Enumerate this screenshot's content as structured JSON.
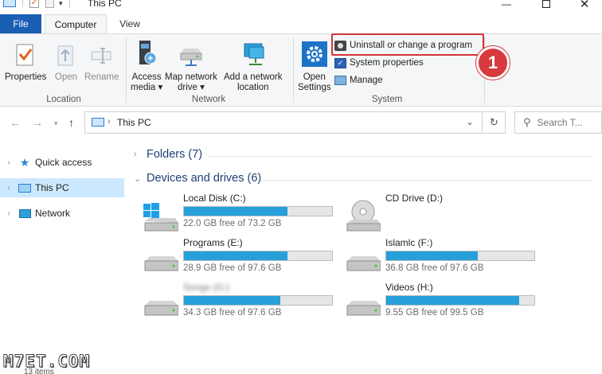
{
  "window": {
    "title": "This PC",
    "controls": [
      "minimize-icon",
      "maximize-icon",
      "close-icon"
    ]
  },
  "ribbon": {
    "tabs": [
      {
        "label": "File"
      },
      {
        "label": "Computer"
      },
      {
        "label": "View"
      }
    ],
    "groups": {
      "location": {
        "label": "Location",
        "buttons": [
          {
            "label": "Properties",
            "icon": "properties-icon"
          },
          {
            "label": "Open",
            "icon": "open-icon"
          },
          {
            "label": "Rename",
            "icon": "rename-icon"
          }
        ]
      },
      "network": {
        "label": "Network",
        "buttons": [
          {
            "label1": "Access",
            "label2": "media ▾",
            "icon": "access-media-icon"
          },
          {
            "label1": "Map network",
            "label2": "drive ▾",
            "icon": "map-network-drive-icon"
          },
          {
            "label1": "Add a network",
            "label2": "location",
            "icon": "add-network-location-icon"
          }
        ]
      },
      "system": {
        "label": "System",
        "open_settings": {
          "label1": "Open",
          "label2": "Settings",
          "icon": "gear-icon"
        },
        "items": [
          {
            "label": "Uninstall or change a program",
            "icon": "uninstall-icon"
          },
          {
            "label": "System properties",
            "icon": "system-properties-icon"
          },
          {
            "label": "Manage",
            "icon": "manage-icon"
          }
        ]
      }
    },
    "callout_number": "1",
    "accent": "#1a5fb4",
    "highlight_color": "#d0343a"
  },
  "address_bar": {
    "path": "This PC",
    "search_placeholder": "Search T..."
  },
  "nav_pane": {
    "items": [
      {
        "label": "Quick access",
        "icon": "star-icon"
      },
      {
        "label": "This PC",
        "icon": "computer-icon",
        "selected": true
      },
      {
        "label": "Network",
        "icon": "network-icon"
      }
    ]
  },
  "content": {
    "folders_heading": "Folders (7)",
    "drives_heading": "Devices and drives (6)",
    "drives": [
      {
        "name": "Local Disk (C:)",
        "free": "22.0 GB free of 73.2 GB",
        "used_fraction": 0.7,
        "icon": "windows-drive-icon"
      },
      {
        "name": "CD Drive (D:)",
        "free": "",
        "used_fraction": null,
        "icon": "cd-drive-icon"
      },
      {
        "name": "Programs (E:)",
        "free": "28.9 GB free of 97.6 GB",
        "used_fraction": 0.7,
        "icon": "hard-drive-icon"
      },
      {
        "name": "Islamlc (F:)",
        "free": "36.8 GB free of 97.6 GB",
        "used_fraction": 0.62,
        "icon": "hard-drive-icon"
      },
      {
        "name": "Songs (G:)",
        "free": "34.3 GB free of 97.6 GB",
        "used_fraction": 0.65,
        "icon": "hard-drive-icon",
        "blurred": true
      },
      {
        "name": "Videos (H:)",
        "free": "9.55 GB free of 99.5 GB",
        "used_fraction": 0.9,
        "icon": "hard-drive-icon"
      }
    ],
    "bar_color": "#26a0da"
  },
  "watermark": "M7ET.COM",
  "status": "13 items"
}
